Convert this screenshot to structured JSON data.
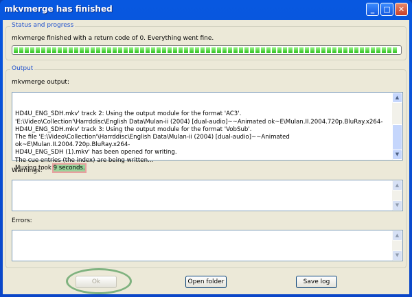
{
  "window": {
    "title": "mkvmerge has finished",
    "buttons": [
      "minimize",
      "maximize",
      "close"
    ]
  },
  "status": {
    "group_label": "Status and progress",
    "message": "mkvmerge finished with a return code of 0. Everything went fine.",
    "progress_percent": 100
  },
  "output": {
    "group_label": "Output",
    "output_label": "mkvmerge output:",
    "lines": [
      "HD4U_ENG_SDH.mkv' track 2: Using the output module for the format 'AC3'.",
      "'E:\\Video\\Collection'\\Harrddisc\\English Data\\Mulan-ii (2004) [dual-audio]~~Animated ok~E\\Mulan.II.2004.720p.BluRay.x264-",
      "HD4U_ENG_SDH.mkv' track 3: Using the output module for the format 'VobSub'.",
      "The file 'E:\\Video\\Collection'\\Harrddisc\\English Data\\Mulan-ii (2004) [dual-audio]~~Animated ok~E\\Mulan.II.2004.720p.BluRay.x264-",
      "HD4U_ENG_SDH (1).mkv' has been opened for writing.",
      "The cue entries (the index) are being written...",
      "Muxing took "
    ],
    "highlight": "9 seconds.",
    "warnings_label": "Warnings:",
    "warnings": "",
    "errors_label": "Errors:",
    "errors": ""
  },
  "buttons": {
    "ok": "Ok",
    "open_folder": "Open folder",
    "save_log": "Save log"
  }
}
